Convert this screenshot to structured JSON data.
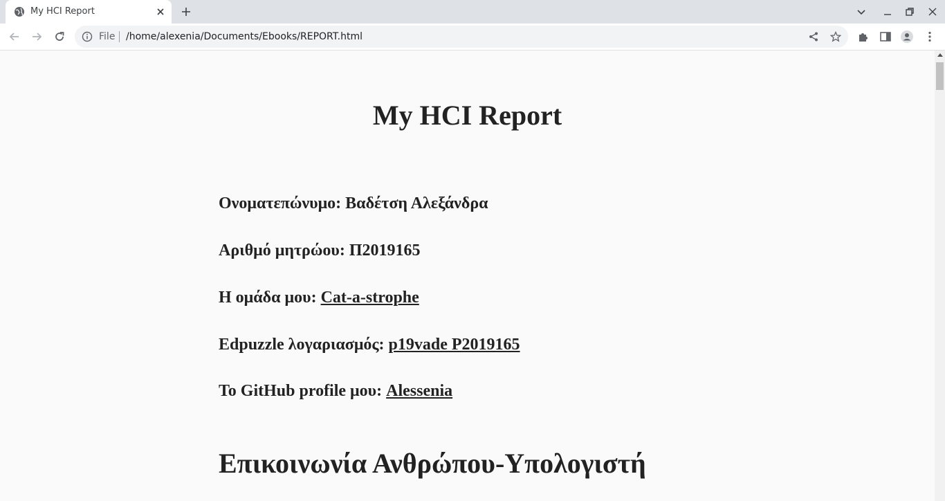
{
  "browser": {
    "tab": {
      "title": "My HCI Report"
    },
    "omnibox": {
      "scheme": "File",
      "url": "/home/alexenia/Documents/Ebooks/REPORT.html"
    }
  },
  "page": {
    "title": "My HCI Report",
    "info": [
      {
        "label": "Ονοματεπώνυμο: Βαδέτση Αλεξάνδρα",
        "link": ""
      },
      {
        "label": "Αριθμό μητρώου: Π2019165",
        "link": ""
      },
      {
        "label": "Η ομάδα μου: ",
        "link": "Cat-a-strophe"
      },
      {
        "label": "Edpuzzle λογαριασμός: ",
        "link": "p19vade P2019165"
      },
      {
        "label": "To GitHub profile μου: ",
        "link": "Alessenia"
      }
    ],
    "section_title": "Επικοινωνία Ανθρώπου-Υπολογιστή"
  },
  "colors": {
    "tabstrip": "#dee1e6",
    "omnibox": "#f1f3f4",
    "page_bg": "#fafafa",
    "text": "#222222"
  }
}
